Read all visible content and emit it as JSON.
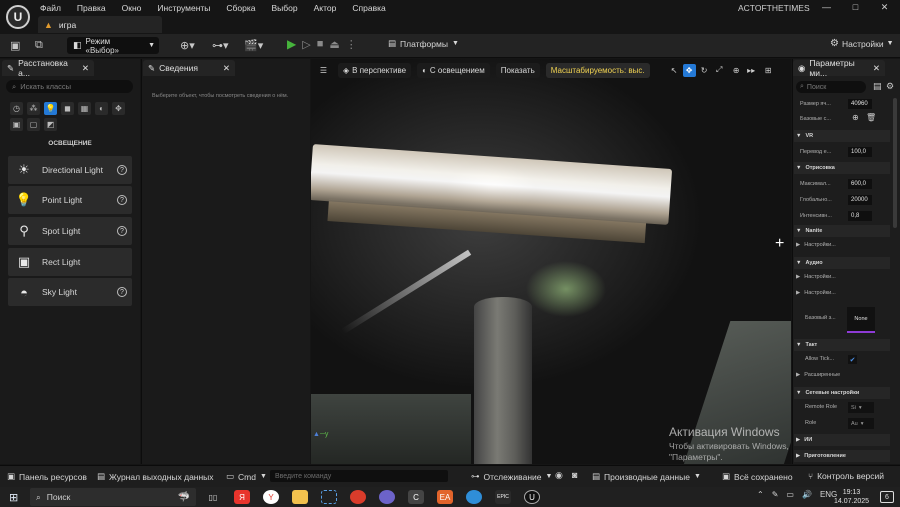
{
  "menu": [
    "Файл",
    "Правка",
    "Окно",
    "Инструменты",
    "Сборка",
    "Выбор",
    "Актор",
    "Справка"
  ],
  "project_tab": "игра",
  "project_name": "ACTOFTHETIMES",
  "window_controls": [
    "—",
    "□",
    "✕"
  ],
  "toolbar": {
    "mode_label": "Режим «Выбор»",
    "platforms_label": "Платформы",
    "settings_label": "Настройки"
  },
  "place_panel": {
    "tab_label": "Расстановка а...",
    "search_placeholder": "Искать классы",
    "category_title": "ОСВЕЩЕНИЕ",
    "items": [
      {
        "label": "Directional Light",
        "icon": "sun-icon"
      },
      {
        "label": "Point Light",
        "icon": "bulb-icon"
      },
      {
        "label": "Spot Light",
        "icon": "spotlight-icon"
      },
      {
        "label": "Rect Light",
        "icon": "rect-light-icon"
      },
      {
        "label": "Sky Light",
        "icon": "sky-light-icon"
      }
    ]
  },
  "details_panel": {
    "tab_label": "Сведения",
    "hint": "Выберите объект, чтобы посмотреть сведения о нём."
  },
  "viewport": {
    "perspective_label": "В перспективе",
    "lit_label": "С освещением",
    "show_label": "Показать",
    "scalability_label": "Масштабируемость: выс.",
    "watermark_title": "Активация Windows",
    "watermark_text": "Чтобы активировать Windows, перейдите в раздел \"Параметры\"."
  },
  "props_panel": {
    "tab_label": "Параметры ми...",
    "search_placeholder": "Поиск",
    "rows": [
      {
        "label": "Размер яч...",
        "value": "40960"
      },
      {
        "label": "Базовые с...",
        "value": ""
      }
    ],
    "vr_section": "VR",
    "vr_rows": [
      {
        "label": "Перевод е...",
        "value": "100,0"
      }
    ],
    "render_section": "Отрисовка",
    "render_rows": [
      {
        "label": "Максимал...",
        "value": "600,0"
      },
      {
        "label": "Глобально...",
        "value": "20000"
      },
      {
        "label": "Интенсивн...",
        "value": "0,8"
      }
    ],
    "nanite_section": "Nanite",
    "nanite_sub": "Настройки...",
    "audio_section": "Аудио",
    "audio_sub_1": "Настройки...",
    "audio_sub_2": "Настройки...",
    "base_label": "Базовый з...",
    "base_value": "None",
    "tick_section": "Такт",
    "allow_tick_label": "Allow Tick...",
    "advanced_label": "Расширенные",
    "network_section": "Сетевые настройки",
    "remote_role_label": "Remote Role",
    "remote_role_value": "Si",
    "role_label": "Role",
    "role_value": "Au",
    "ii_section": "ИИ",
    "cooking_section": "Приготовление"
  },
  "statusbar": {
    "content_browser": "Панель ресурсов",
    "output_log": "Журнал выходных данных",
    "cmd_label": "Cmd",
    "cmd_placeholder": "Введите команду",
    "trace_label": "Отслеживание",
    "derived_data": "Производные данные",
    "all_saved": "Всё сохранено",
    "source_control": "Контроль версий"
  },
  "taskbar": {
    "search_label": "Поиск",
    "lang": "ENG",
    "time": "19:13",
    "date": "14.07.2025",
    "notifications": "6",
    "apps": [
      "Я",
      "Y",
      "",
      "",
      "",
      "",
      "C",
      "EA",
      "",
      "EPIC",
      "U"
    ]
  }
}
